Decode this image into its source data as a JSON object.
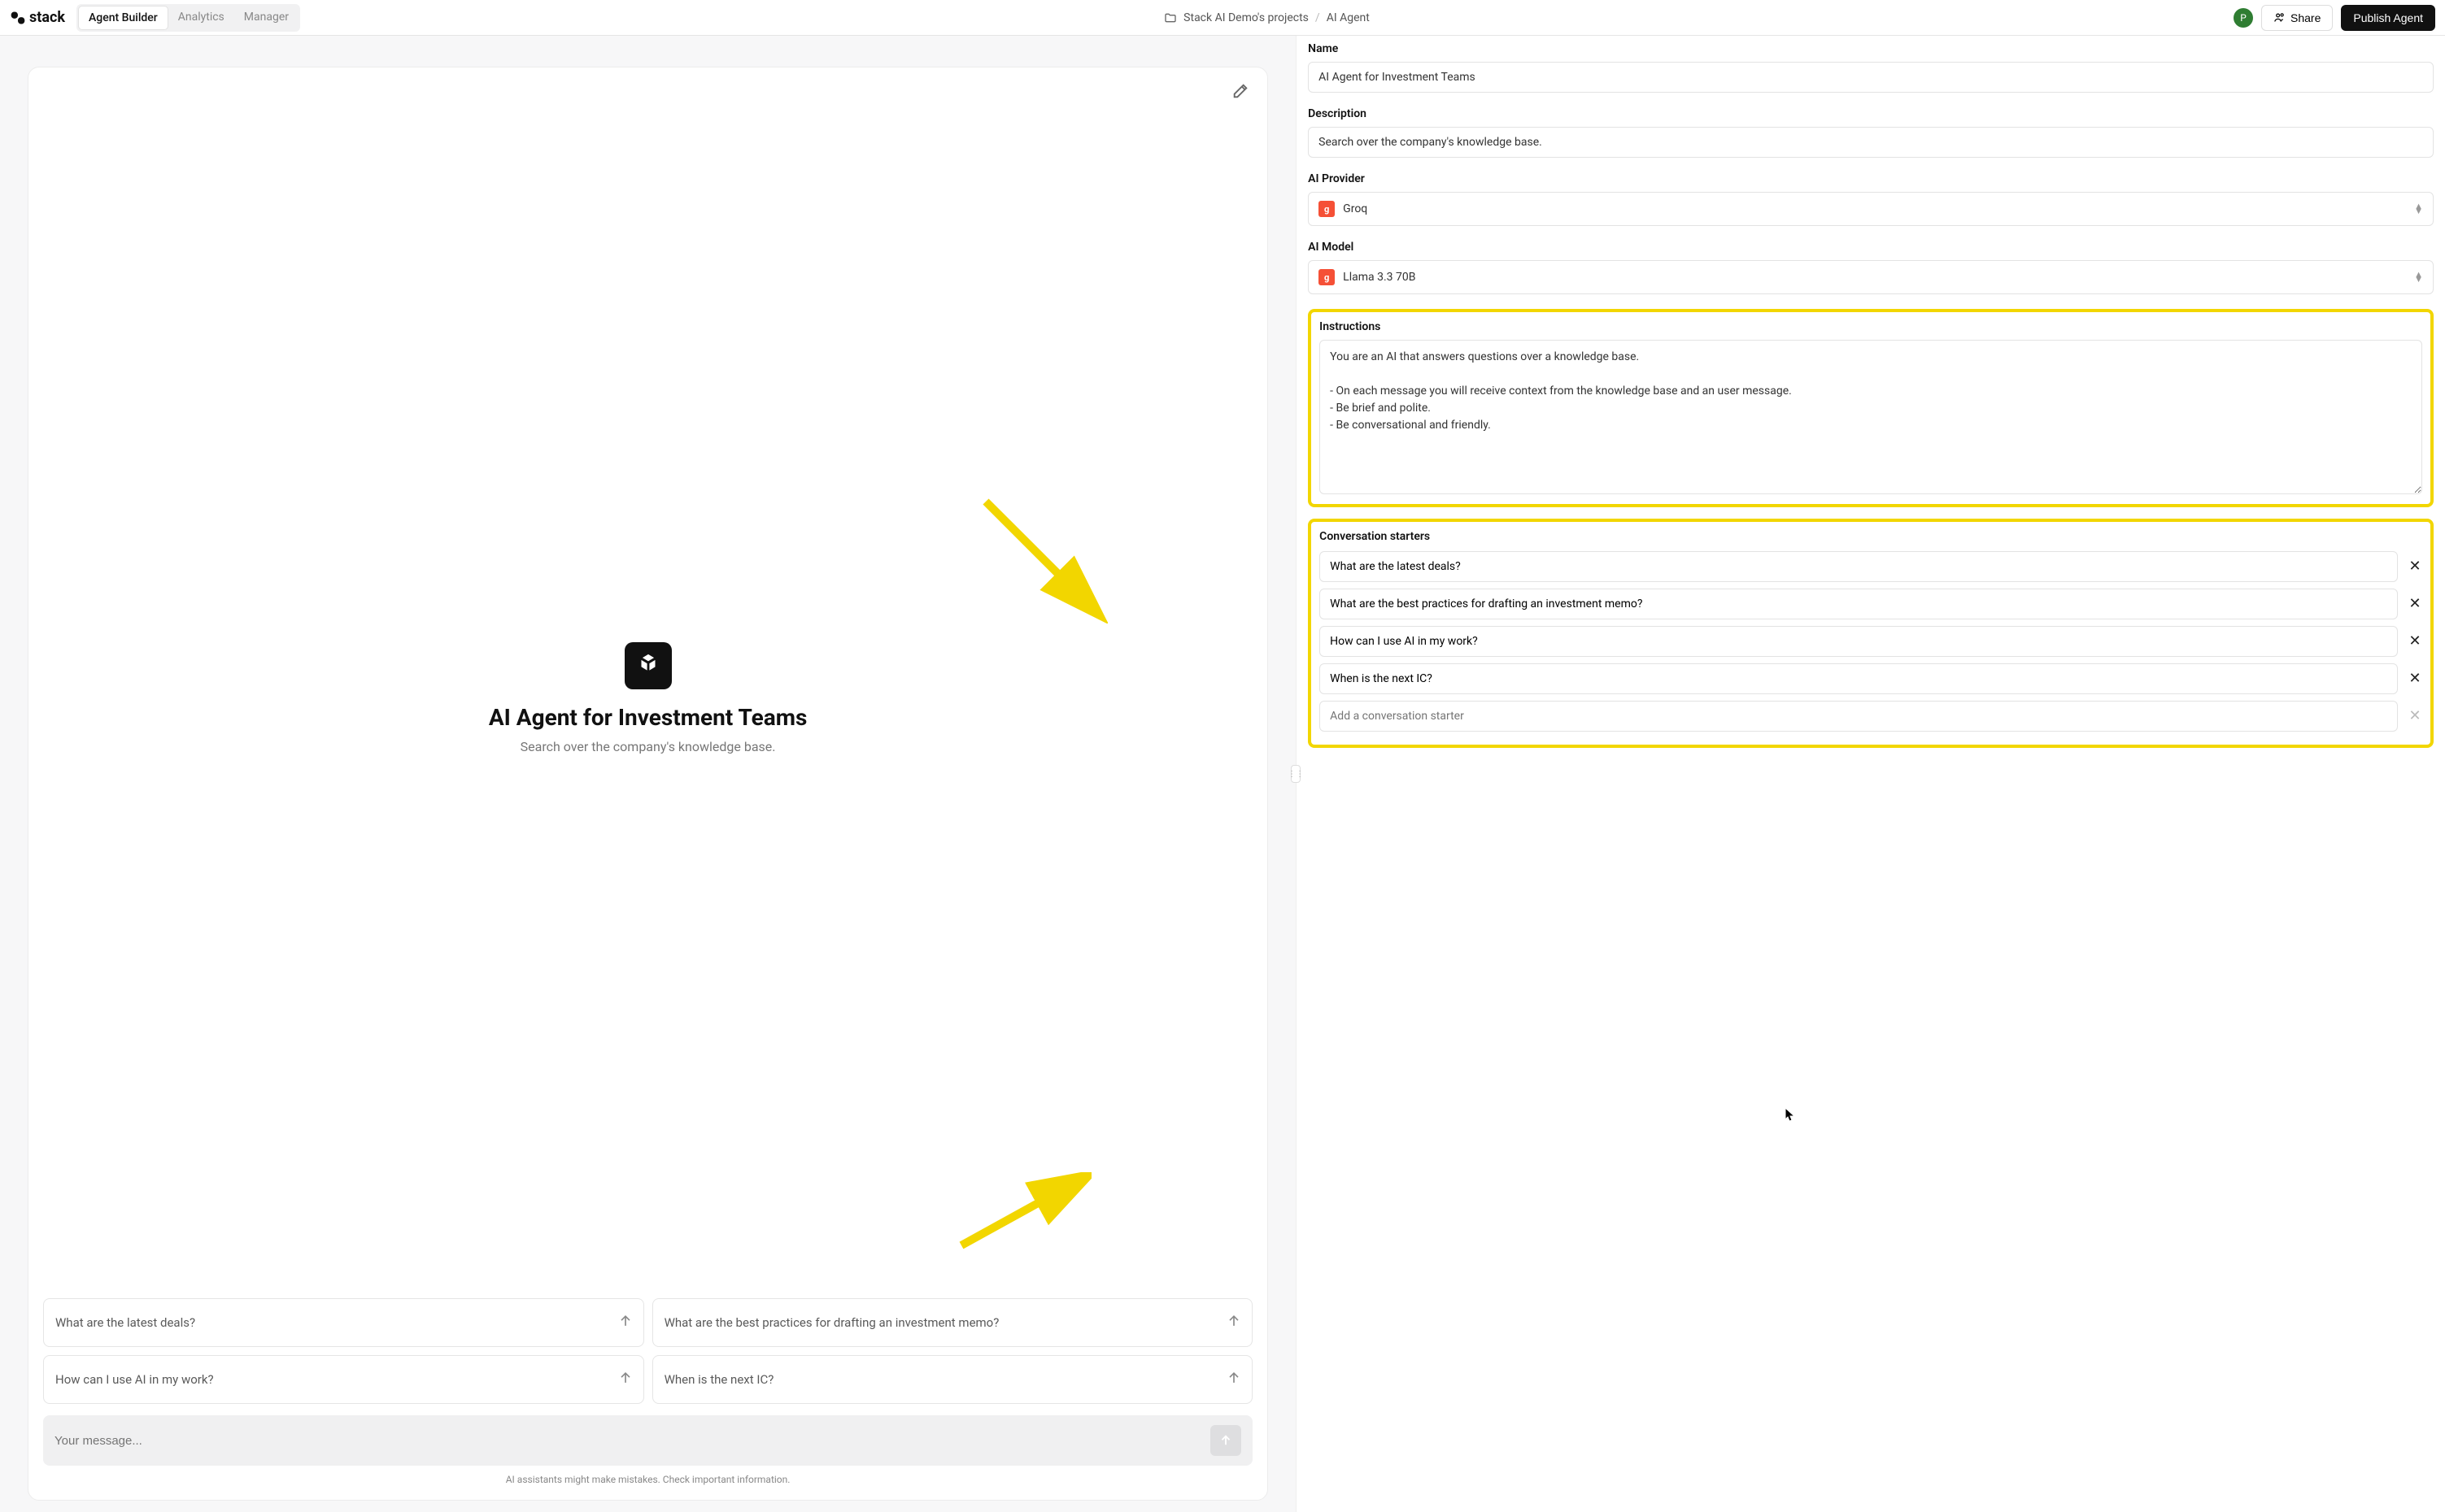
{
  "header": {
    "brand": "stack",
    "tabs": [
      "Agent Builder",
      "Analytics",
      "Manager"
    ],
    "breadcrumb": {
      "project": "Stack AI Demo's projects",
      "page": "AI Agent"
    },
    "avatar_initial": "P",
    "share_label": "Share",
    "publish_label": "Publish Agent"
  },
  "preview": {
    "title": "AI Agent for Investment Teams",
    "subtitle": "Search over the company's knowledge base.",
    "starters": [
      "What are the latest deals?",
      "What are the best practices for drafting an investment memo?",
      "How can I use AI in my work?",
      "When is the next IC?"
    ],
    "composer_placeholder": "Your message...",
    "disclaimer": "AI assistants might make mistakes. Check important information."
  },
  "form": {
    "name_label": "Name",
    "name_value": "AI Agent for Investment Teams",
    "desc_label": "Description",
    "desc_value": "Search over the company's knowledge base.",
    "provider_label": "AI Provider",
    "provider_value": "Groq",
    "provider_badge": "g",
    "model_label": "AI Model",
    "model_value": "Llama 3.3 70B",
    "instructions_label": "Instructions",
    "instructions_value": "You are an AI that answers questions over a knowledge base.\n\n- On each message you will receive context from the knowledge base and an user message.\n- Be brief and polite.\n- Be conversational and friendly.",
    "starters_label": "Conversation starters",
    "starters": [
      "What are the latest deals?",
      "What are the best practices for drafting an investment memo?",
      "How can I use AI in my work?",
      "When is the next IC?"
    ],
    "starter_add_placeholder": "Add a conversation starter"
  },
  "annotation": {
    "arrow_color": "#f2d600"
  }
}
